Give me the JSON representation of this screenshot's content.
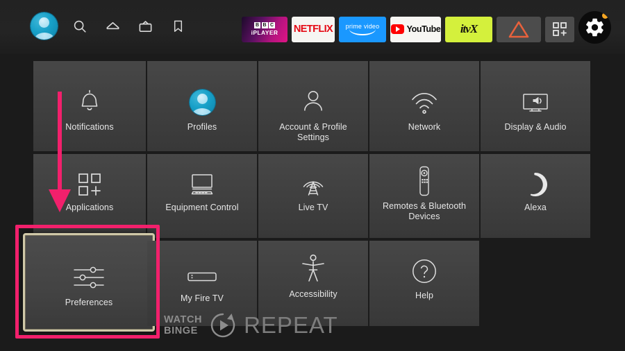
{
  "topbar": {
    "avatar": {
      "name": "profile-avatar"
    },
    "nav_icons": [
      {
        "id": "search",
        "label": "Search"
      },
      {
        "id": "home",
        "label": "Home"
      },
      {
        "id": "live-tv",
        "label": "Live TV"
      },
      {
        "id": "bookmark",
        "label": "Watchlist"
      }
    ],
    "apps": [
      {
        "id": "bbc-iplayer",
        "bbc": [
          "B",
          "B",
          "C"
        ],
        "label": "iPLAYER"
      },
      {
        "id": "netflix",
        "label": "NETFLIX"
      },
      {
        "id": "prime-video",
        "label": "prime video"
      },
      {
        "id": "youtube",
        "label": "YouTube"
      },
      {
        "id": "itvx",
        "label": "itvX"
      },
      {
        "id": "triangle-app",
        "label": ""
      },
      {
        "id": "app-library",
        "label": ""
      }
    ],
    "settings_gear": {
      "label": "Settings",
      "has_notification": true,
      "dot_color": "#f5a623"
    }
  },
  "grid": {
    "rows": [
      [
        {
          "id": "notifications",
          "label": "Notifications",
          "icon": "bell-icon"
        },
        {
          "id": "profiles",
          "label": "Profiles",
          "icon": "profile-avatar-icon"
        },
        {
          "id": "account-profile-settings",
          "label": "Account & Profile Settings",
          "icon": "person-icon"
        },
        {
          "id": "network",
          "label": "Network",
          "icon": "wifi-icon"
        },
        {
          "id": "display-audio",
          "label": "Display & Audio",
          "icon": "tv-speaker-icon"
        }
      ],
      [
        {
          "id": "applications",
          "label": "Applications",
          "icon": "app-grid-icon"
        },
        {
          "id": "equipment-control",
          "label": "Equipment Control",
          "icon": "monitor-icon"
        },
        {
          "id": "live-tv",
          "label": "Live TV",
          "icon": "antenna-icon"
        },
        {
          "id": "remotes-bluetooth-devices",
          "label": "Remotes & Bluetooth Devices",
          "icon": "remote-icon"
        },
        {
          "id": "alexa",
          "label": "Alexa",
          "icon": "alexa-ring-icon"
        }
      ],
      [
        {
          "id": "preferences",
          "label": "Preferences",
          "icon": "sliders-icon",
          "focused": true
        },
        {
          "id": "my-fire-tv",
          "label": "My Fire TV",
          "icon": "firestick-icon"
        },
        {
          "id": "accessibility",
          "label": "Accessibility",
          "icon": "accessibility-icon"
        },
        {
          "id": "help",
          "label": "Help",
          "icon": "question-mark-icon"
        }
      ]
    ]
  },
  "annotations": {
    "highlight_color": "#f2206c",
    "arrow": {
      "color": "#f2206c",
      "points_to": "preferences"
    },
    "focus_box": {
      "target": "preferences",
      "color": "#f2206c"
    }
  },
  "watermark": {
    "line1": "WATCH",
    "line2": "BINGE",
    "word": "REPEAT",
    "icon": "repeat-play-icon"
  }
}
